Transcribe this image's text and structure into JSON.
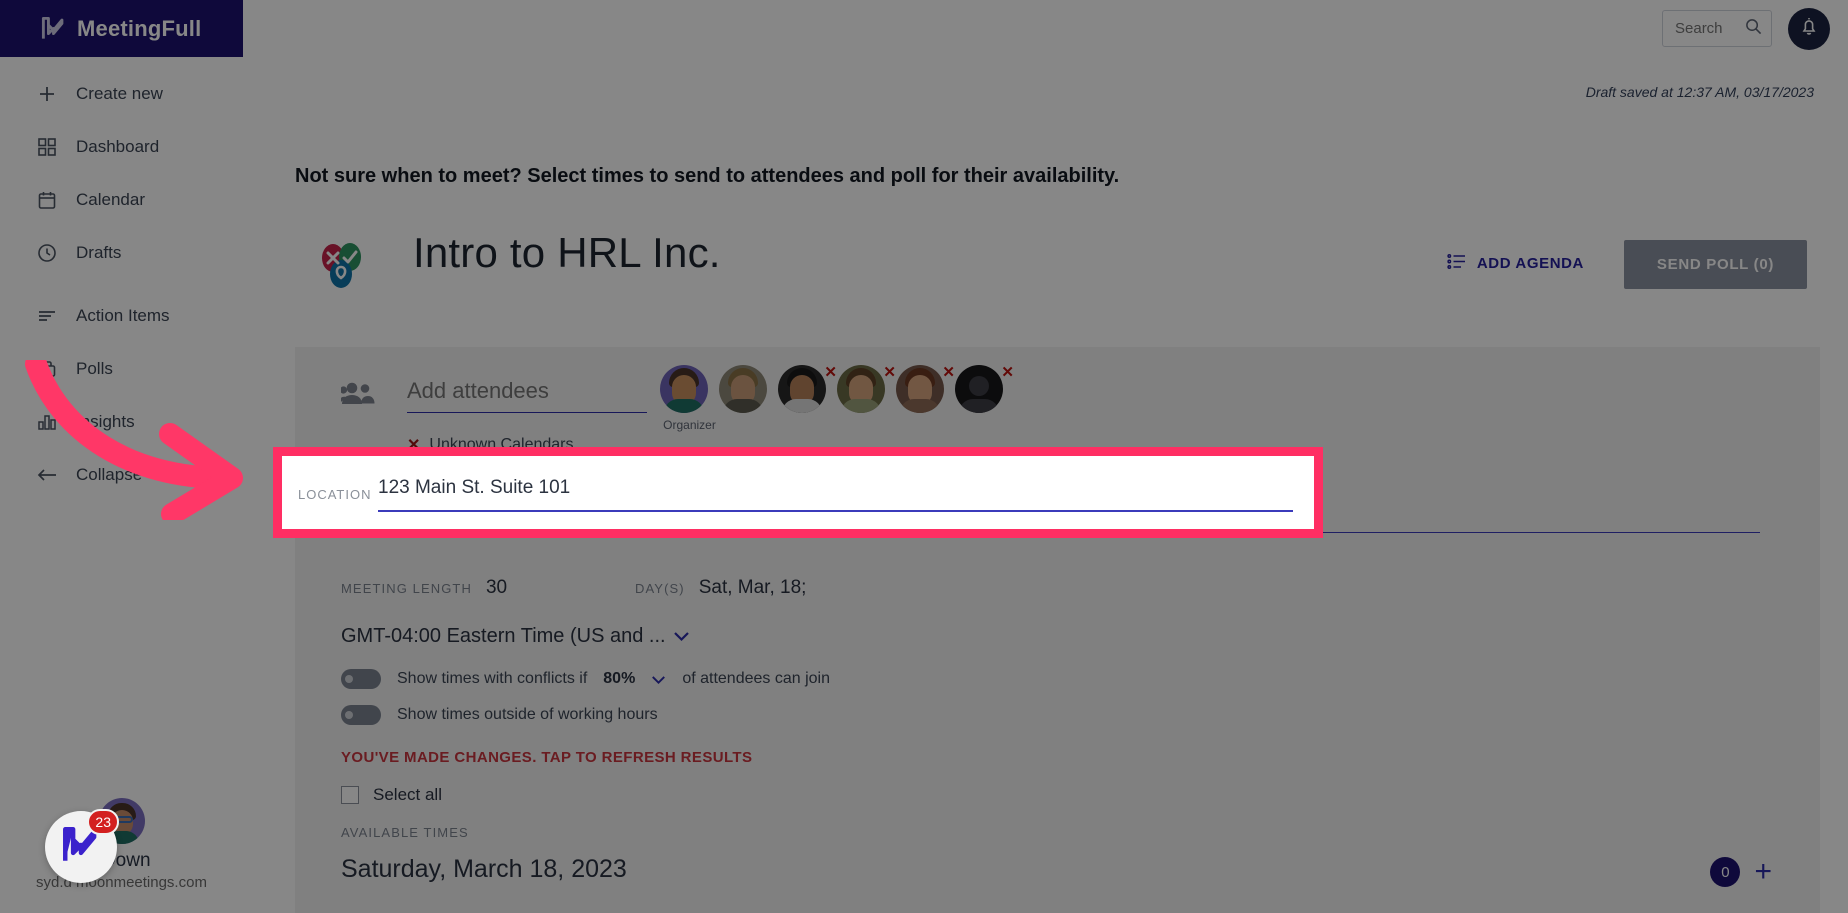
{
  "brand": {
    "name": "MeetingFull",
    "logo_icon": "meetingfull-logo-icon",
    "bg_color": "#1d1270"
  },
  "sidebar": {
    "items": [
      {
        "label": "Create new",
        "icon": "plus-icon"
      },
      {
        "label": "Dashboard",
        "icon": "grid-icon"
      },
      {
        "label": "Calendar",
        "icon": "calendar-icon"
      },
      {
        "label": "Drafts",
        "icon": "clock-icon"
      },
      {
        "label": "Action Items",
        "icon": "list-lines-icon"
      },
      {
        "label": "Polls",
        "icon": "poll-box-icon"
      },
      {
        "label": "Insights",
        "icon": "bar-chart-icon"
      },
      {
        "label": "Collapse",
        "icon": "arrow-left-icon"
      }
    ],
    "user": {
      "name": "l Down",
      "email": "syd.d    moonmeetings.com",
      "avatar_icon": "user-avatar"
    }
  },
  "topbar": {
    "search": {
      "value": "",
      "placeholder": "Search",
      "icon": "search-icon"
    },
    "notifications_icon": "bell-icon"
  },
  "main": {
    "draft_saved": "Draft saved at 12:37 AM, 03/17/2023",
    "prompt": "Not sure when to meet? Select times to send to attendees and poll for their availability.",
    "title": "Intro to HRL Inc.",
    "title_icon": "poll-balloons-icon",
    "add_agenda_label": "ADD AGENDA",
    "add_agenda_icon": "agenda-list-icon",
    "send_poll_label": "SEND POLL (0)",
    "attendees": {
      "icon": "people-icon",
      "input_value": "",
      "input_placeholder": "Add attendees",
      "organizer_label": "Organizer",
      "list": [
        {
          "name": "organizer-avatar",
          "removable": false,
          "label": "Organizer"
        },
        {
          "name": "attendee-avatar-2",
          "removable": false,
          "label": ""
        },
        {
          "name": "attendee-avatar-3",
          "removable": true,
          "label": ""
        },
        {
          "name": "attendee-avatar-4",
          "removable": true,
          "label": ""
        },
        {
          "name": "attendee-avatar-5",
          "removable": true,
          "label": ""
        },
        {
          "name": "attendee-avatar-6",
          "removable": true,
          "label": ""
        }
      ],
      "unknown_calendars_label": "Unknown Calendars",
      "unknown_calendars_icon": "red-x-icon"
    },
    "location": {
      "label": "LOCATION",
      "value": "123 Main St. Suite 101",
      "highlight_color": "#ff2e63"
    },
    "meeting_length": {
      "label": "MEETING LENGTH",
      "value": "30"
    },
    "days": {
      "label": "DAY(S)",
      "value": "Sat, Mar, 18;"
    },
    "timezone": {
      "value": "GMT-04:00 Eastern Time (US and ...",
      "chevron_icon": "chevron-down-icon"
    },
    "toggles": [
      {
        "id": "conflicts",
        "prefix": "Show times with conflicts if",
        "percent": "80%",
        "suffix": "of attendees can join",
        "on": false,
        "chevron_icon": "chevron-down-icon"
      },
      {
        "id": "outside-hours",
        "prefix": "Show times outside of working hours",
        "percent": "",
        "suffix": "",
        "on": false
      }
    ],
    "refresh_message": "YOU'VE MADE CHANGES. TAP TO REFRESH RESULTS",
    "select_all_label": "Select all",
    "select_all_checked": false,
    "available_times_label": "AVAILABLE TIMES",
    "date_heading": "Saturday, March 18, 2023",
    "selected_count": "0",
    "add_icon": "plus-icon"
  },
  "chat_widget": {
    "badge": "23",
    "icon": "meetingfull-logo-icon"
  }
}
